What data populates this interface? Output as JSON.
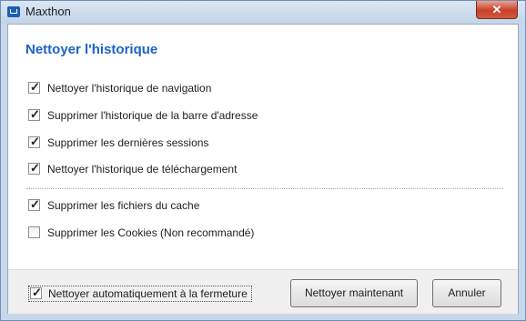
{
  "window": {
    "title": "Maxthon",
    "close_glyph": "✕"
  },
  "dialog": {
    "heading": "Nettoyer l'historique",
    "options": [
      {
        "label": "Nettoyer l'historique de navigation",
        "checked": true
      },
      {
        "label": "Supprimer l'historique de la barre d'adresse",
        "checked": true
      },
      {
        "label": "Supprimer les dernières sessions",
        "checked": true
      },
      {
        "label": "Nettoyer l'historique de téléchargement",
        "checked": true
      },
      {
        "label": "Supprimer les fichiers du cache",
        "checked": true
      },
      {
        "label": "Supprimer les Cookies (Non recommandé)",
        "checked": false
      }
    ]
  },
  "footer": {
    "auto_clean_label": "Nettoyer automatiquement à la fermeture",
    "auto_clean_checked": true,
    "clean_now_label": "Nettoyer maintenant",
    "cancel_label": "Annuler"
  },
  "check_glyph": "✓"
}
